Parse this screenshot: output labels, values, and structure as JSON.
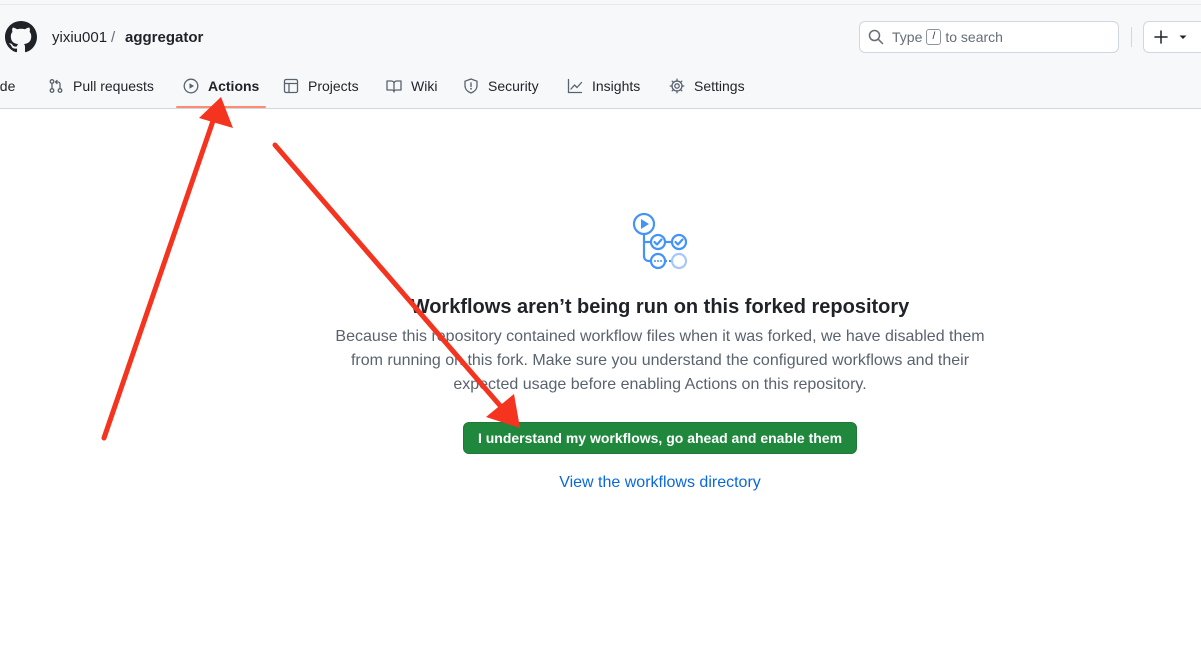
{
  "header": {
    "owner": "yixiu001",
    "separator": "/",
    "repo": "aggregator",
    "search": {
      "prefix": "Type",
      "key": "/",
      "suffix": "to search"
    }
  },
  "tabs": [
    {
      "label": "ode",
      "icon": "code-icon",
      "active": false
    },
    {
      "label": "Pull requests",
      "icon": "git-pull-request-icon",
      "active": false
    },
    {
      "label": "Actions",
      "icon": "play-icon",
      "active": true
    },
    {
      "label": "Projects",
      "icon": "table-icon",
      "active": false
    },
    {
      "label": "Wiki",
      "icon": "book-icon",
      "active": false
    },
    {
      "label": "Security",
      "icon": "shield-icon",
      "active": false
    },
    {
      "label": "Insights",
      "icon": "graph-icon",
      "active": false
    },
    {
      "label": "Settings",
      "icon": "gear-icon",
      "active": false
    }
  ],
  "main": {
    "title": "Workflows aren’t being run on this forked repository",
    "description": "Because this repository contained workflow files when it was forked, we have disabled them from running on this fork. Make sure you understand the configured workflows and their expected usage before enabling Actions on this repository.",
    "enable_button": "I understand my workflows, go ahead and enable them",
    "directory_link": "View the workflows directory"
  },
  "colors": {
    "primary_button": "#1f883d",
    "link": "#0969da",
    "active_tab_underline": "#fd8c73",
    "annotation_arrow": "#f5341f"
  }
}
